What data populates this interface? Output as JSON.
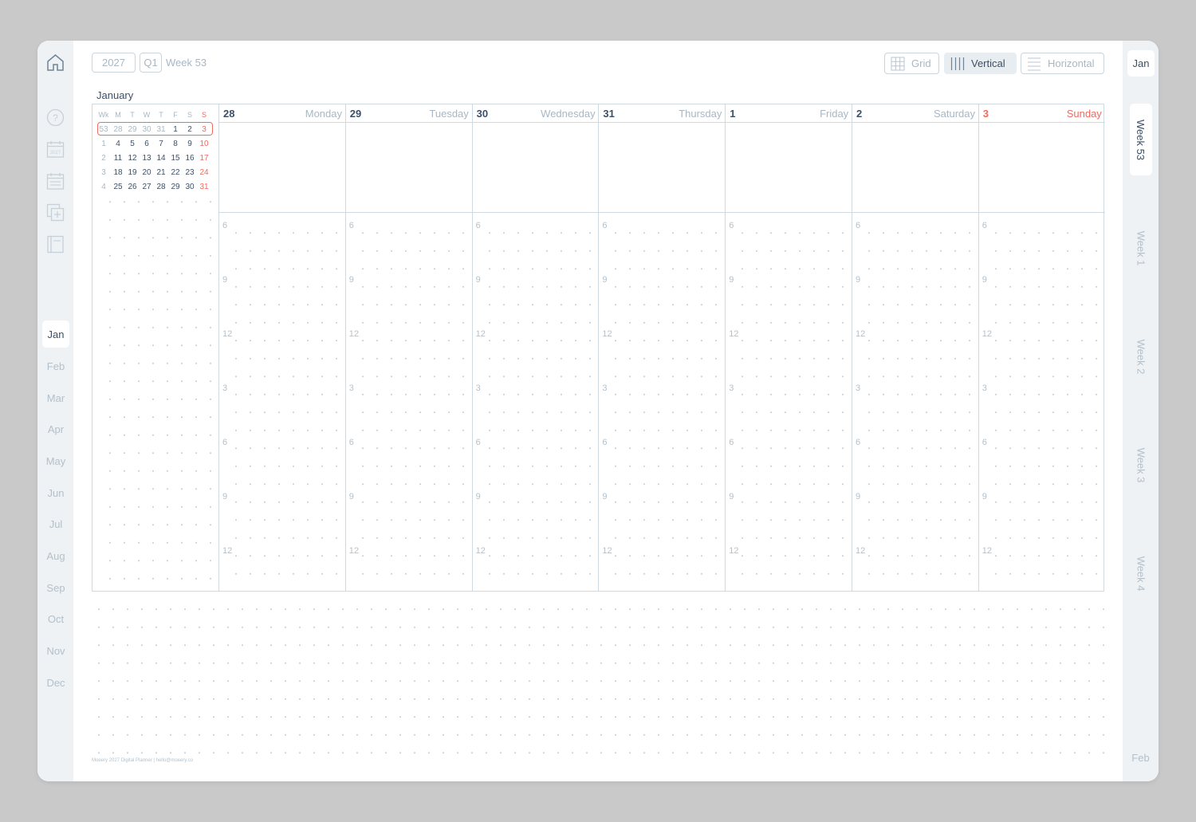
{
  "header": {
    "year": "2027",
    "quarter": "Q1",
    "week": "Week 53",
    "views": [
      {
        "label": "Grid",
        "active": false
      },
      {
        "label": "Vertical",
        "active": true
      },
      {
        "label": "Horizontal",
        "active": false
      }
    ]
  },
  "left_nav": {
    "icons": [
      "home-icon",
      "help-icon",
      "year-calendar-icon",
      "month-calendar-icon",
      "add-page-icon",
      "notebook-icon"
    ],
    "year_icon_text": "2027",
    "months": [
      "Jan",
      "Feb",
      "Mar",
      "Apr",
      "May",
      "Jun",
      "Jul",
      "Aug",
      "Sep",
      "Oct",
      "Nov",
      "Dec"
    ],
    "active_month": "Jan"
  },
  "right_nav": {
    "current_month": "Jan",
    "weeks": [
      "Week 53",
      "Week 1",
      "Week 2",
      "Week 3",
      "Week 4"
    ],
    "active_week": "Week 53",
    "next_month": "Feb"
  },
  "mini_calendar": {
    "month": "January",
    "headers": [
      "Wk",
      "M",
      "T",
      "W",
      "T",
      "F",
      "S",
      "S"
    ],
    "rows": [
      [
        "53",
        "28",
        "29",
        "30",
        "31",
        "1",
        "2",
        "3"
      ],
      [
        "1",
        "4",
        "5",
        "6",
        "7",
        "8",
        "9",
        "10"
      ],
      [
        "2",
        "11",
        "12",
        "13",
        "14",
        "15",
        "16",
        "17"
      ],
      [
        "3",
        "18",
        "19",
        "20",
        "21",
        "22",
        "23",
        "24"
      ],
      [
        "4",
        "25",
        "26",
        "27",
        "28",
        "29",
        "30",
        "31"
      ]
    ],
    "highlighted_week": "53"
  },
  "days": [
    {
      "num": "28",
      "name": "Monday"
    },
    {
      "num": "29",
      "name": "Tuesday"
    },
    {
      "num": "30",
      "name": "Wednesday"
    },
    {
      "num": "31",
      "name": "Thursday"
    },
    {
      "num": "1",
      "name": "Friday"
    },
    {
      "num": "2",
      "name": "Saturday"
    },
    {
      "num": "3",
      "name": "Sunday"
    }
  ],
  "hours": [
    "6",
    "9",
    "12",
    "3",
    "6",
    "9",
    "12"
  ],
  "footer": "Moeery 2027 Digital Planner | hello@moeery.co",
  "colors": {
    "accent": "#f06a5f",
    "text": "#3d4f66",
    "muted": "#a9b7c3",
    "rail": "#eef2f4",
    "line": "#cfd9e1"
  }
}
